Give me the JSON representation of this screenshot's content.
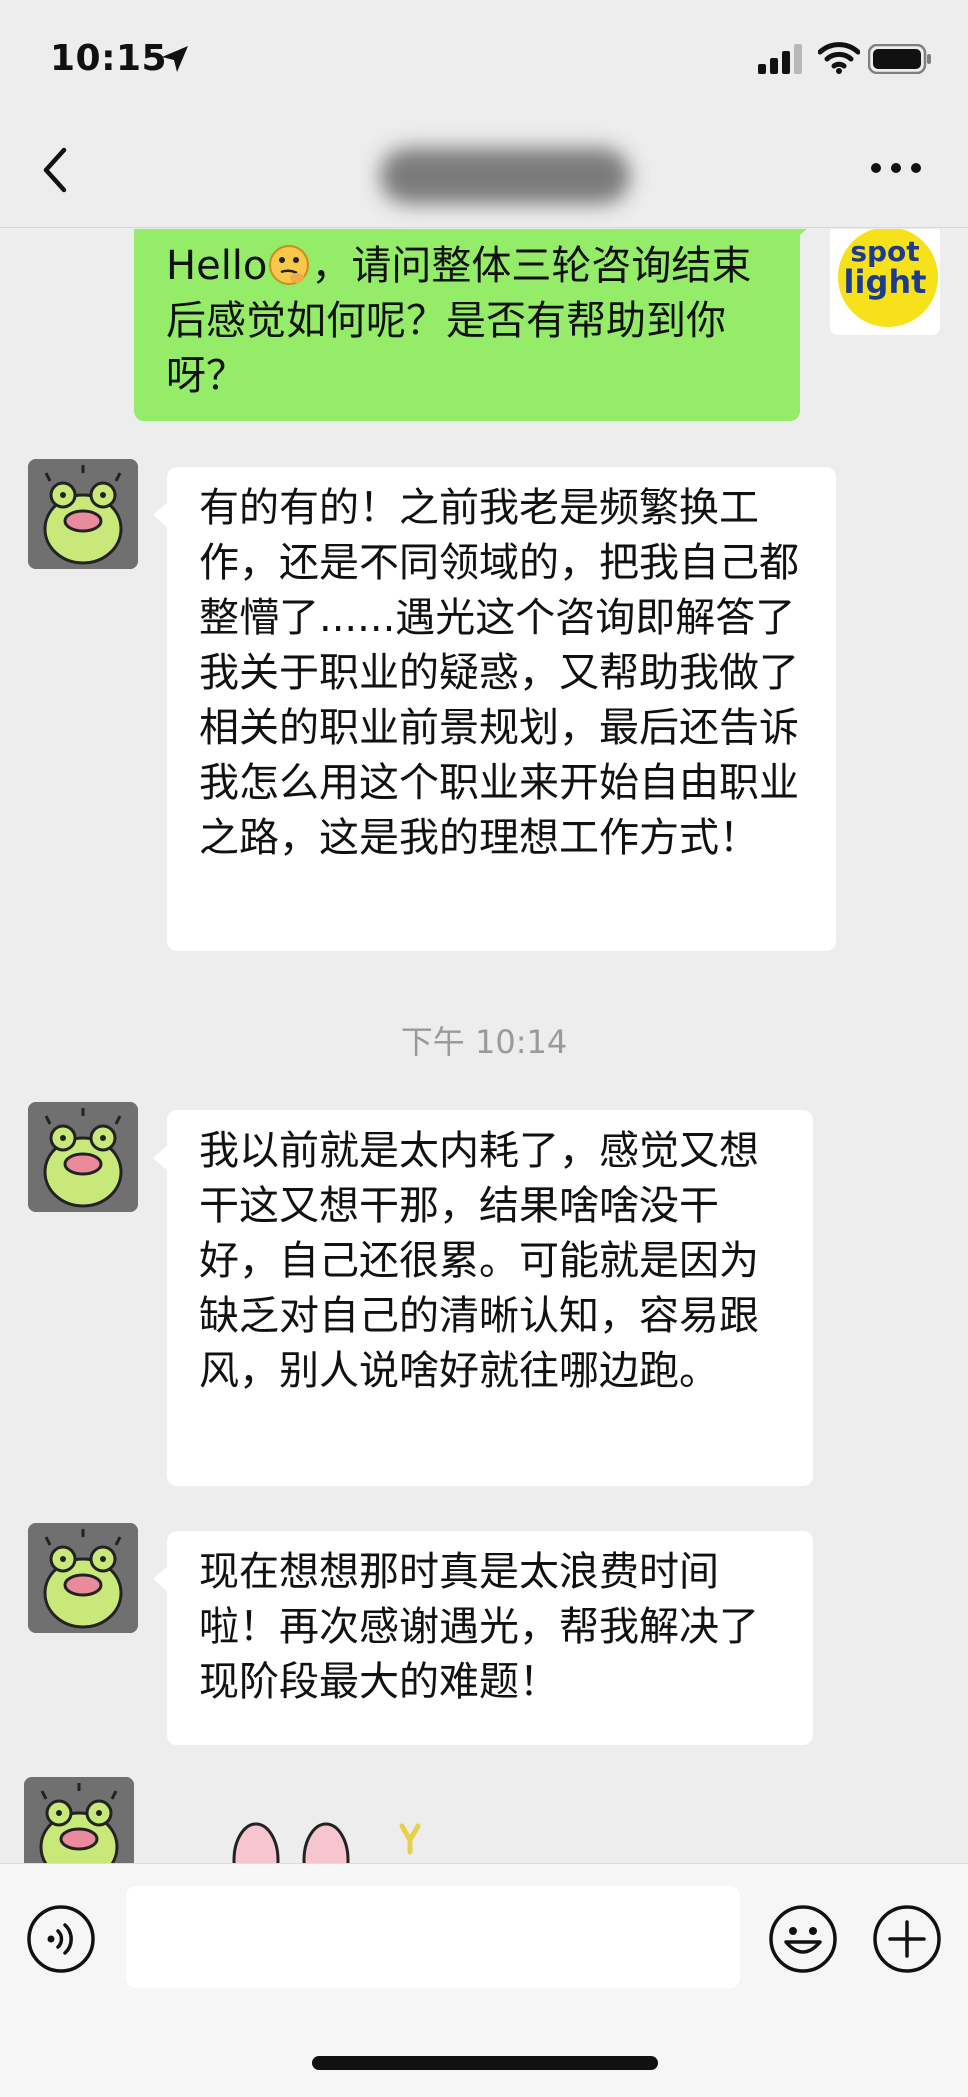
{
  "status_bar": {
    "time": "10:15",
    "icons": [
      "location-arrow-icon",
      "signal-icon",
      "wifi-icon",
      "battery-icon"
    ]
  },
  "nav": {
    "back_icon": "chevron-left-icon",
    "more_icon": "more-icon"
  },
  "messages": [
    {
      "direction": "outgoing",
      "sender_avatar": {
        "line1": "spot",
        "line2": "light",
        "color": "#f6e11a"
      },
      "prefix": "Hello",
      "emoji": "thinking-emoji-icon",
      "text": "，请问整体三轮咨询结束后感觉如何呢？是否有帮助到你呀？"
    },
    {
      "direction": "incoming",
      "avatar": "frog-avatar",
      "text": "有的有的！之前我老是频繁换工作，还是不同领域的，把我自己都整懵了......遇光这个咨询即解答了我关于职业的疑惑，又帮助我做了相关的职业前景规划，最后还告诉我怎么用这个职业来开始自由职业之路，这是我的理想工作方式！"
    },
    {
      "type": "timestamp",
      "text": "下午 10:14"
    },
    {
      "direction": "incoming",
      "avatar": "frog-avatar",
      "text": "我以前就是太内耗了，感觉又想干这又想干那，结果啥啥没干好，自己还很累。可能就是因为缺乏对自己的清晰认知，容易跟风，别人说啥好就往哪边跑。"
    },
    {
      "direction": "incoming",
      "avatar": "frog-avatar",
      "text": "现在想想那时真是太浪费时间啦！再次感谢遇光，帮我解决了现阶段最大的难题！"
    },
    {
      "direction": "incoming",
      "avatar": "frog-avatar",
      "sticker": "bunny-sticker"
    }
  ],
  "input_bar": {
    "value": "",
    "icons": [
      "voice-icon",
      "emoji-icon",
      "plus-icon"
    ]
  },
  "colors": {
    "background": "#ededed",
    "outgoing_bubble": "#95ec69",
    "incoming_bubble": "#ffffff",
    "timestamp_text": "#9a9a9a"
  }
}
